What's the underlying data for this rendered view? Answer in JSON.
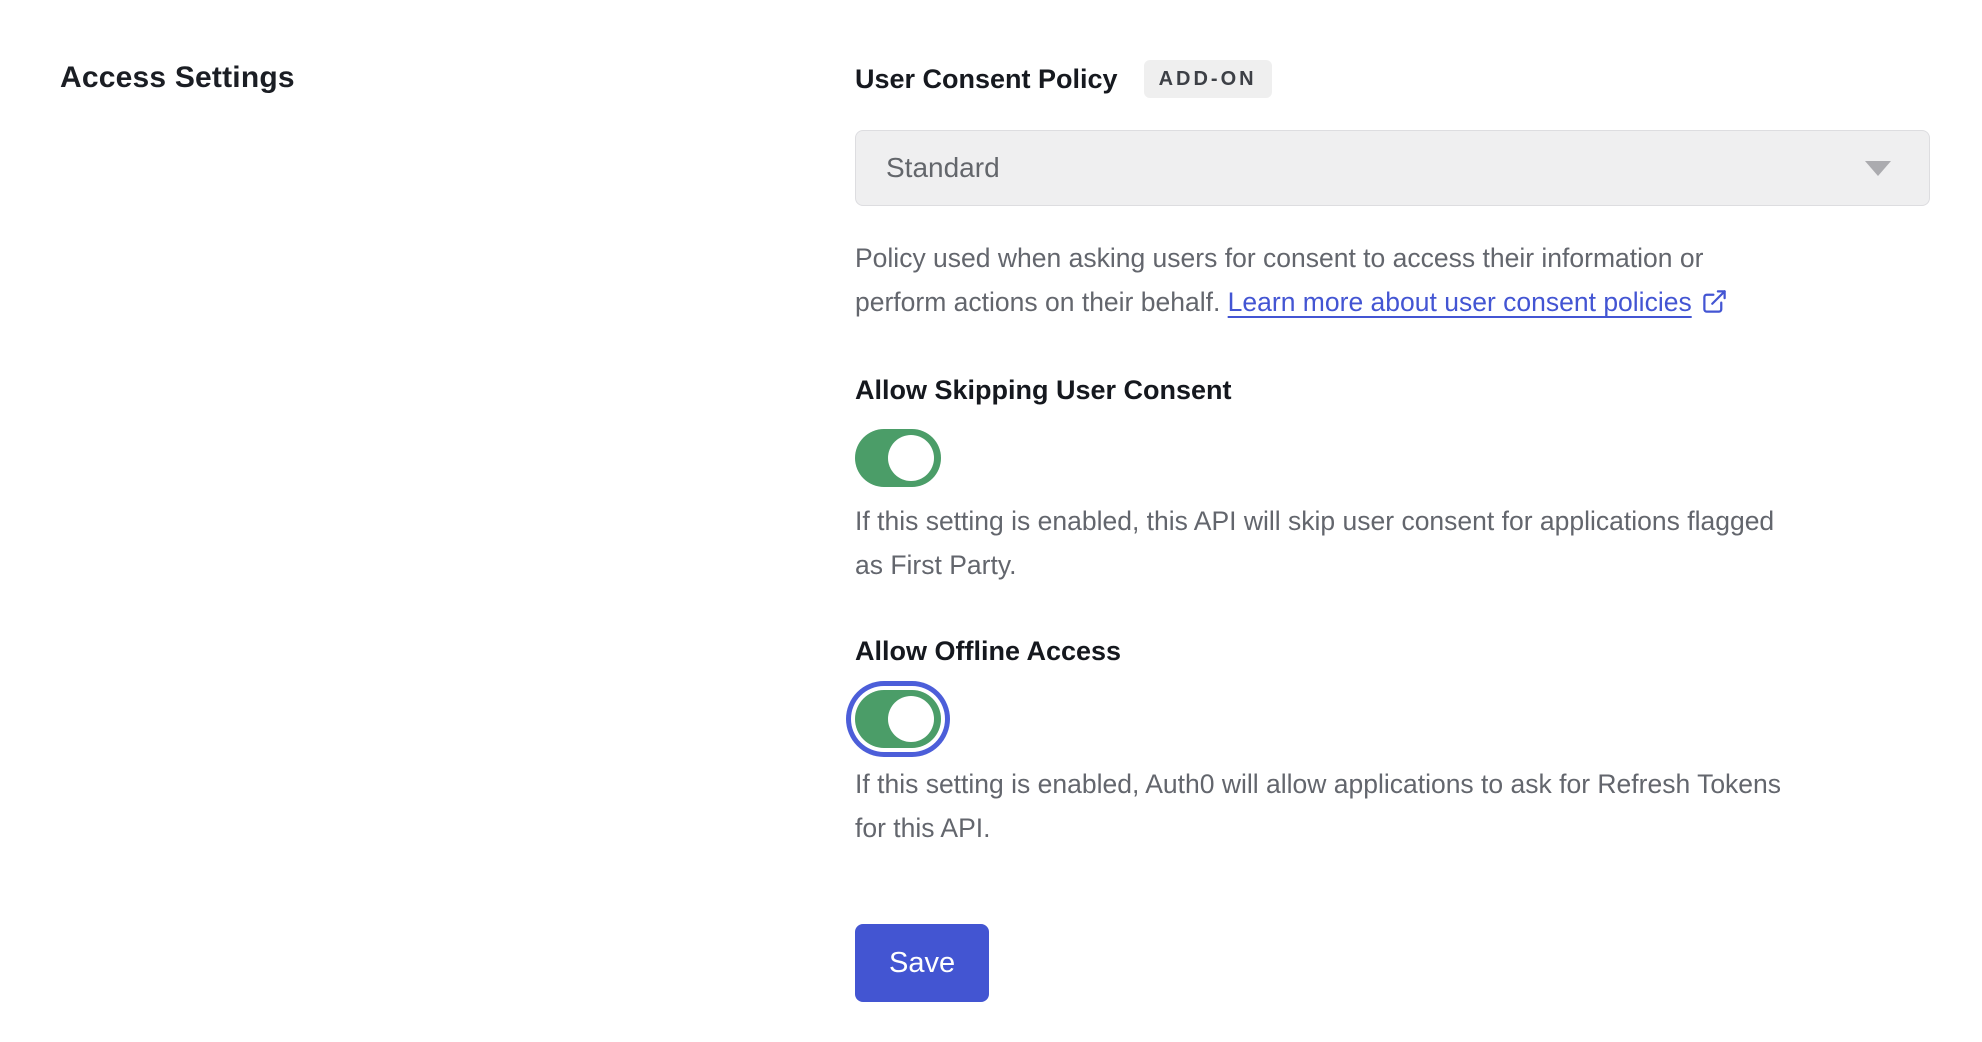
{
  "page": {
    "section_title": "Access Settings"
  },
  "consent_policy": {
    "label": "User Consent Policy",
    "badge": "ADD-ON",
    "select_value": "Standard",
    "description_line1": "Policy used when asking users for consent to access their information or",
    "description_line2_prefix": "perform actions on their behalf. ",
    "link_text": "Learn more about user consent policies"
  },
  "skip_consent": {
    "label": "Allow Skipping User Consent",
    "enabled": true,
    "description_line1": "If this setting is enabled, this API will skip user consent for applications flagged",
    "description_line2": "as First Party."
  },
  "offline_access": {
    "label": "Allow Offline Access",
    "enabled": true,
    "focused": true,
    "description_line1": "If this setting is enabled, Auth0 will allow applications to ask for Refresh Tokens",
    "description_line2": "for this API."
  },
  "actions": {
    "save_label": "Save"
  },
  "colors": {
    "accent_blue": "#4355d2",
    "link_blue": "#4355d3",
    "toggle_green": "#4b9d68",
    "focus_ring_blue": "#4c5ed9",
    "badge_bg": "#efefef",
    "select_bg": "#efeff0"
  }
}
